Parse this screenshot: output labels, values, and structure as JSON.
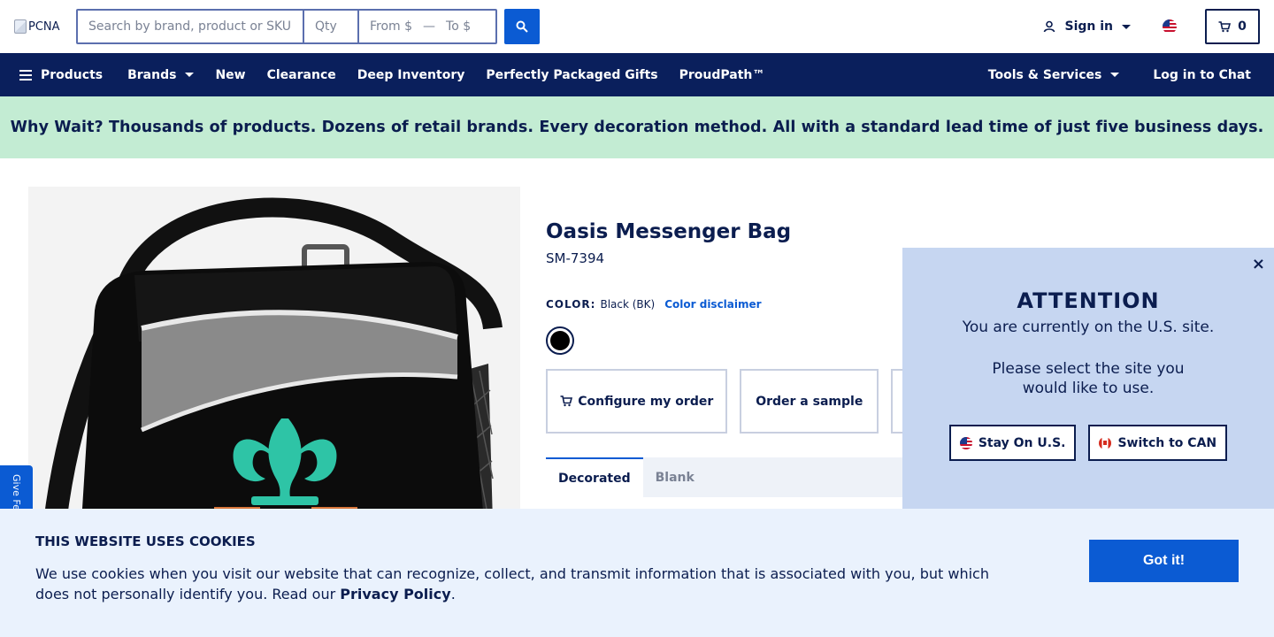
{
  "header": {
    "logo_alt": "PCNA",
    "search_placeholder": "Search by brand, product or SKU",
    "qty_placeholder": "Qty",
    "price_from_placeholder": "From $",
    "price_separator": "—",
    "price_to_placeholder": "To $",
    "signin_label": "Sign in",
    "cart_count": "0"
  },
  "nav": {
    "products": "Products",
    "brands": "Brands",
    "new": "New",
    "clearance": "Clearance",
    "deep_inventory": "Deep Inventory",
    "gifts": "Perfectly Packaged Gifts",
    "proudpath": "ProudPath™",
    "tools": "Tools & Services",
    "chat": "Log in to Chat"
  },
  "banner": {
    "text": "Why Wait? Thousands of products. Dozens of retail brands. Every decoration method. All with a standard lead time of just five business days."
  },
  "feedback": {
    "label": "Give Fe"
  },
  "product": {
    "title": "Oasis Messenger Bag",
    "sku": "SM-7394",
    "color_label": "COLOR:",
    "color_value": "Black (BK)",
    "color_disclaimer": "Color disclaimer",
    "configure_label": "Configure my order",
    "sample_label": "Order a sample",
    "tabs": [
      "Decorated",
      "Blank"
    ]
  },
  "region_popup": {
    "heading": "ATTENTION",
    "line1": "You are currently on the U.S. site.",
    "line2": "Please select the site you would like to use.",
    "stay_label": "Stay On U.S.",
    "switch_label": "Switch to CAN",
    "close_glyph": "×"
  },
  "cookie": {
    "heading": "THIS WEBSITE USES COOKIES",
    "body": "We use cookies when you visit our website that can recognize, collect, and transmit information that is associated with you, but which does not personally identify you. Read our",
    "link": "Privacy Policy",
    "end": ".",
    "button": "Got it!"
  },
  "colors": {
    "navy": "#0a1f5c",
    "accent_blue": "#0b5bd3",
    "banner_green": "#c3ecd3",
    "popup_blue": "#c6d6f1",
    "cookie_bg": "#eaf2fd",
    "teal_logo": "#2ec4a6"
  }
}
